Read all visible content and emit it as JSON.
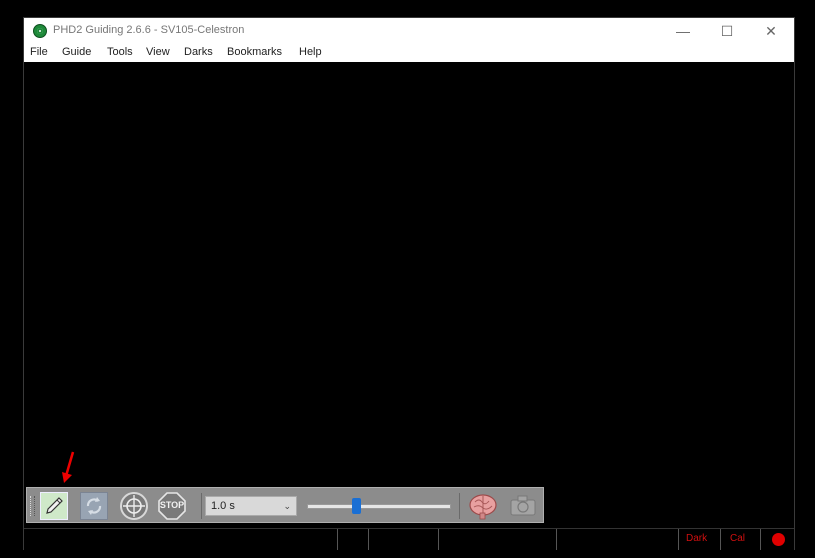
{
  "window": {
    "title": "PHD2 Guiding 2.6.6 - SV105-Celestron",
    "controls": [
      "—",
      "☐",
      "✕"
    ]
  },
  "menu": [
    "File",
    "Guide",
    "Tools",
    "View",
    "Darks",
    "Bookmarks",
    "Help"
  ],
  "toolbar": {
    "loop_icon": "pencil-icon",
    "auto_select_icon": "refresh-icon",
    "guide_icon": "crosshair-icon",
    "stop_label": "STOP",
    "exposure_value": "1.0 s",
    "gamma_level": 0.33,
    "brain_icon": "brain-icon",
    "camera_icon": "camera-icon"
  },
  "status": {
    "dark_label": "Dark",
    "cal_label": "Cal",
    "led_color": "#e00000"
  },
  "accent_colors": {
    "slider": "#1a6fd4",
    "status_text": "#d01010"
  }
}
